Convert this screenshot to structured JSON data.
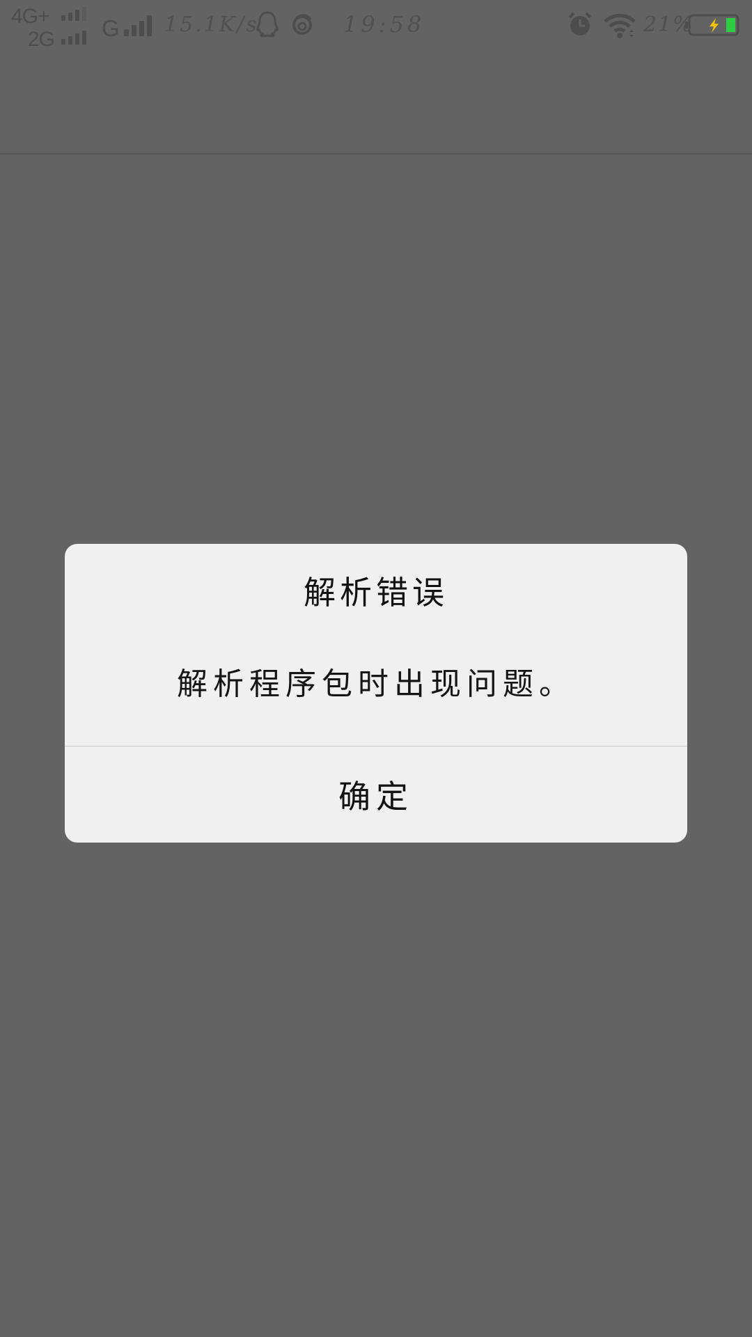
{
  "status_bar": {
    "network_1": "4G+",
    "network_2": "2G",
    "network_3": "G",
    "speed": "15.1K/s",
    "time": "19:58",
    "battery_percent": "21%",
    "icons": [
      "signal-icon",
      "qq-icon",
      "weibo-icon",
      "alarm-icon",
      "wifi-icon",
      "battery-charging-icon"
    ],
    "battery_color": "#2ecc40",
    "charging_bolt_color": "#f5c400"
  },
  "dialog": {
    "title": "解析错误",
    "message": "解析程序包时出现问题。",
    "ok_label": "确定"
  },
  "colors": {
    "background": "#636363",
    "dialog_background": "#f0f0f0",
    "divider": "#c9c9c9"
  }
}
